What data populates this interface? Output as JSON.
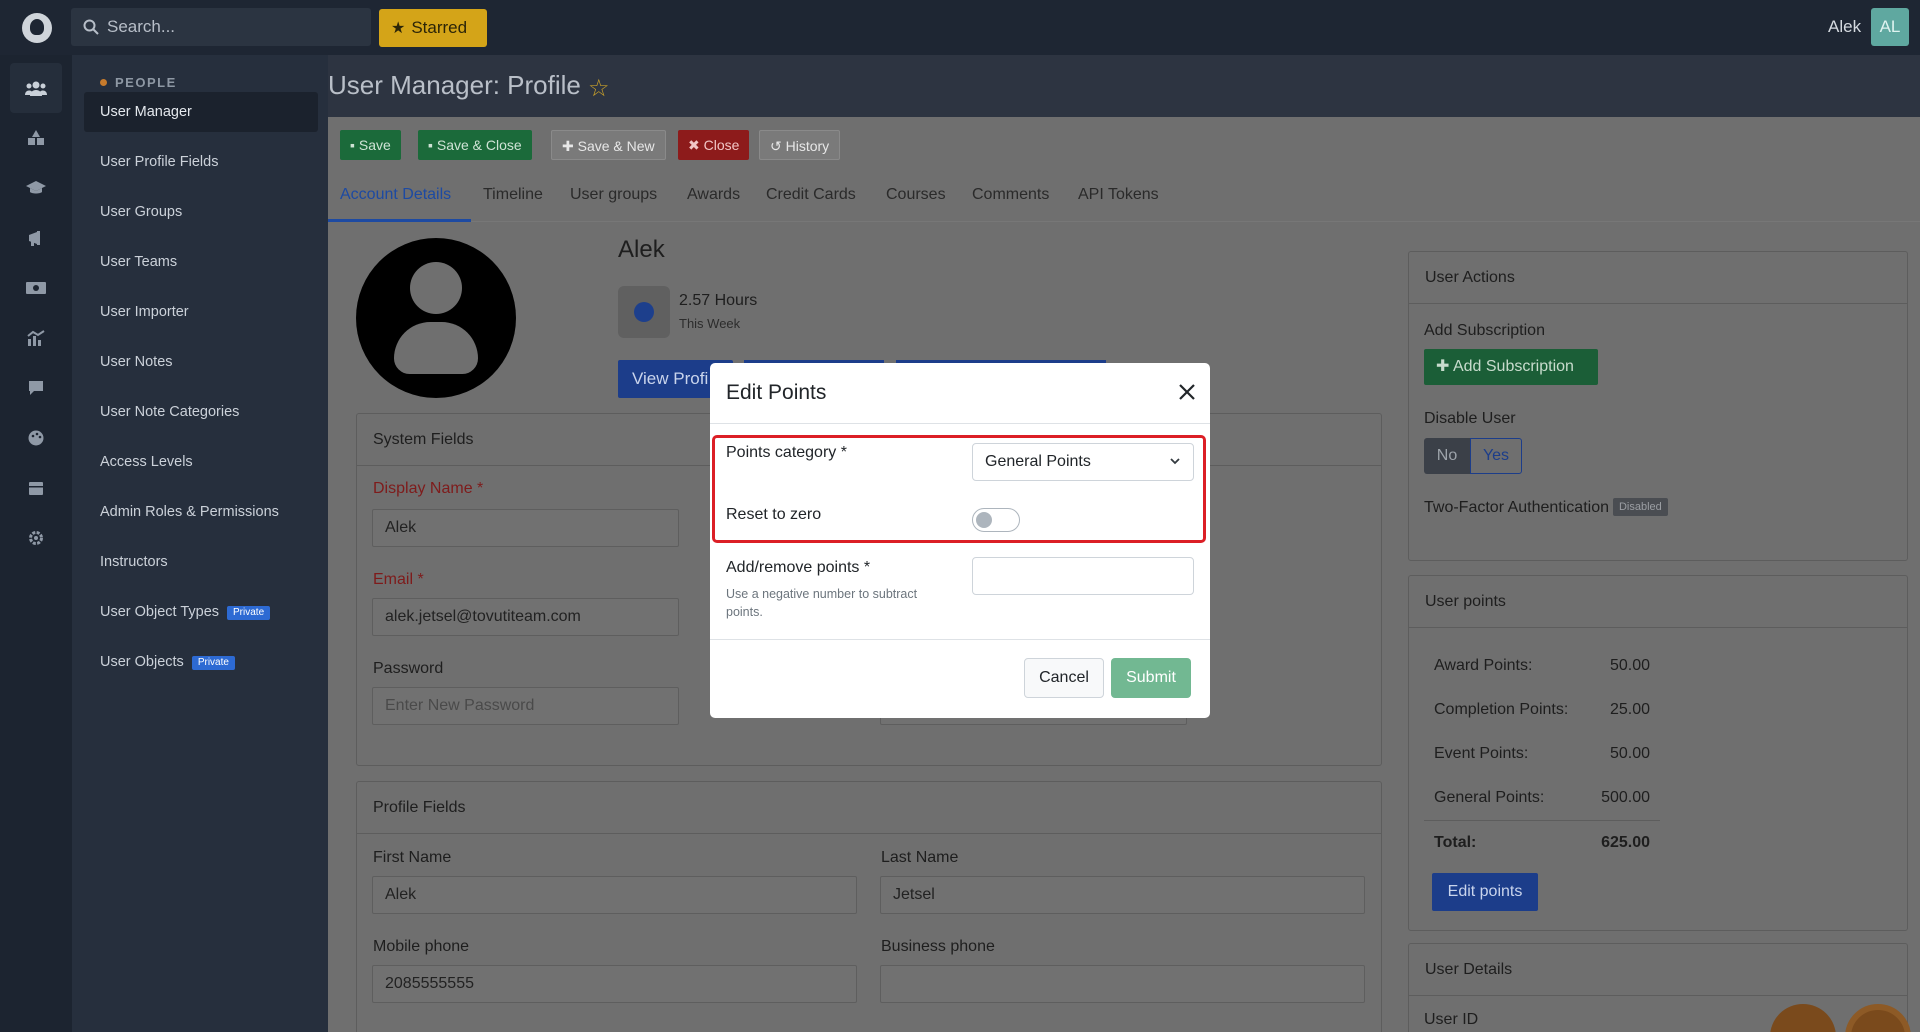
{
  "topbar": {
    "search_placeholder": "Search...",
    "starred_label": "Starred",
    "user_name": "Alek",
    "avatar_initials": "AL"
  },
  "rail": {
    "icons": [
      "users-icon",
      "shapes-icon",
      "graduation-cap-icon",
      "megaphone-icon",
      "money-icon",
      "chart-icon",
      "chat-icon",
      "palette-icon",
      "calendar-icon",
      "gear-icon"
    ]
  },
  "sidebar": {
    "section": "PEOPLE",
    "items": [
      {
        "label": "User Manager"
      },
      {
        "label": "User Profile Fields"
      },
      {
        "label": "User Groups"
      },
      {
        "label": "User Teams"
      },
      {
        "label": "User Importer"
      },
      {
        "label": "User Notes"
      },
      {
        "label": "User Note Categories"
      },
      {
        "label": "Access Levels"
      },
      {
        "label": "Admin Roles & Permissions"
      },
      {
        "label": "Instructors"
      },
      {
        "label": "User Object Types",
        "badge": "Private"
      },
      {
        "label": "User Objects",
        "badge": "Private"
      }
    ]
  },
  "page": {
    "title": "User Manager: Profile"
  },
  "toolbar": {
    "save": "Save",
    "save_close": "Save & Close",
    "save_new": "Save & New",
    "close": "Close",
    "history": "History"
  },
  "tabs": [
    "Account Details",
    "Timeline",
    "User groups",
    "Awards",
    "Credit Cards",
    "Courses",
    "Comments",
    "API Tokens"
  ],
  "profile": {
    "name": "Alek",
    "hours_value": "2.57 Hours",
    "hours_sub": "This Week",
    "view_profile": "View Profi"
  },
  "system_fields": {
    "heading": "System Fields",
    "display_name_label": "Display Name *",
    "display_name_value": "Alek",
    "email_label": "Email *",
    "email_value": "alek.jetsel@tovutiteam.com",
    "password_label": "Password",
    "password_placeholder": "Enter New Password"
  },
  "profile_fields": {
    "heading": "Profile Fields",
    "first_name_label": "First Name",
    "first_name_value": "Alek",
    "last_name_label": "Last Name",
    "last_name_value": "Jetsel",
    "mobile_label": "Mobile phone",
    "mobile_value": "2085555555",
    "business_label": "Business phone",
    "business_value": ""
  },
  "user_actions": {
    "heading": "User Actions",
    "add_subscription_label": "Add Subscription",
    "add_subscription_button": "Add Subscription",
    "disable_user_label": "Disable User",
    "no": "No",
    "yes": "Yes",
    "tfa_label": "Two-Factor Authentication",
    "tfa_badge": "Disabled"
  },
  "user_points": {
    "heading": "User points",
    "rows": [
      {
        "label": "Award Points:",
        "value": "50.00"
      },
      {
        "label": "Completion Points:",
        "value": "25.00"
      },
      {
        "label": "Event Points:",
        "value": "50.00"
      },
      {
        "label": "General Points:",
        "value": "500.00"
      }
    ],
    "total_label": "Total:",
    "total_value": "625.00",
    "edit_button": "Edit points"
  },
  "user_details": {
    "heading": "User Details",
    "user_id_label": "User ID"
  },
  "modal": {
    "title": "Edit Points",
    "category_label": "Points category *",
    "category_value": "General Points",
    "reset_label": "Reset to zero",
    "reset_on": false,
    "add_remove_label": "Add/remove points *",
    "add_remove_help": "Use a negative number to subtract points.",
    "add_remove_value": "",
    "cancel": "Cancel",
    "submit": "Submit",
    "highlight_color": "#dc1f26"
  }
}
